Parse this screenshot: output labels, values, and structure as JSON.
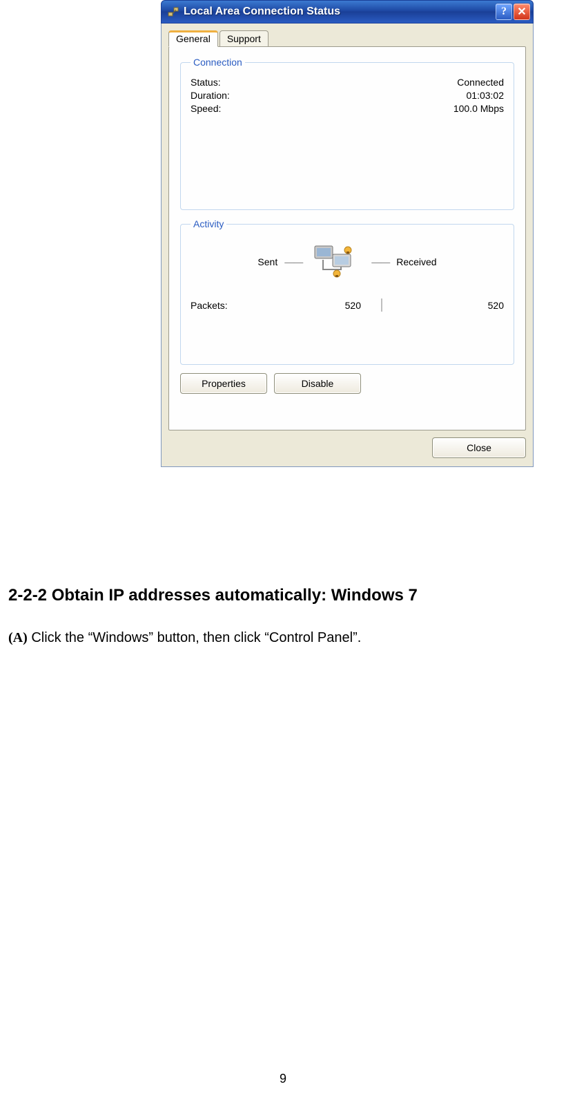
{
  "window": {
    "title": "Local Area Connection Status",
    "help_symbol": "?",
    "close_symbol": "✕"
  },
  "tabs": {
    "general": "General",
    "support": "Support"
  },
  "connection": {
    "legend": "Connection",
    "status_label": "Status:",
    "status_value": "Connected",
    "duration_label": "Duration:",
    "duration_value": "01:03:02",
    "speed_label": "Speed:",
    "speed_value": "100.0 Mbps"
  },
  "activity": {
    "legend": "Activity",
    "sent_label": "Sent",
    "received_label": "Received",
    "packets_label": "Packets:",
    "packets_sent": "520",
    "packets_received": "520",
    "divider": "|",
    "dash": "——"
  },
  "buttons": {
    "properties": "Properties",
    "disable": "Disable",
    "close": "Close"
  },
  "document": {
    "heading": "2-2-2 Obtain IP addresses automatically: Windows 7",
    "step_marker": "(A)",
    "step_text": "Click the “Windows” button, then click “Control Panel”.",
    "page_number": "9"
  }
}
